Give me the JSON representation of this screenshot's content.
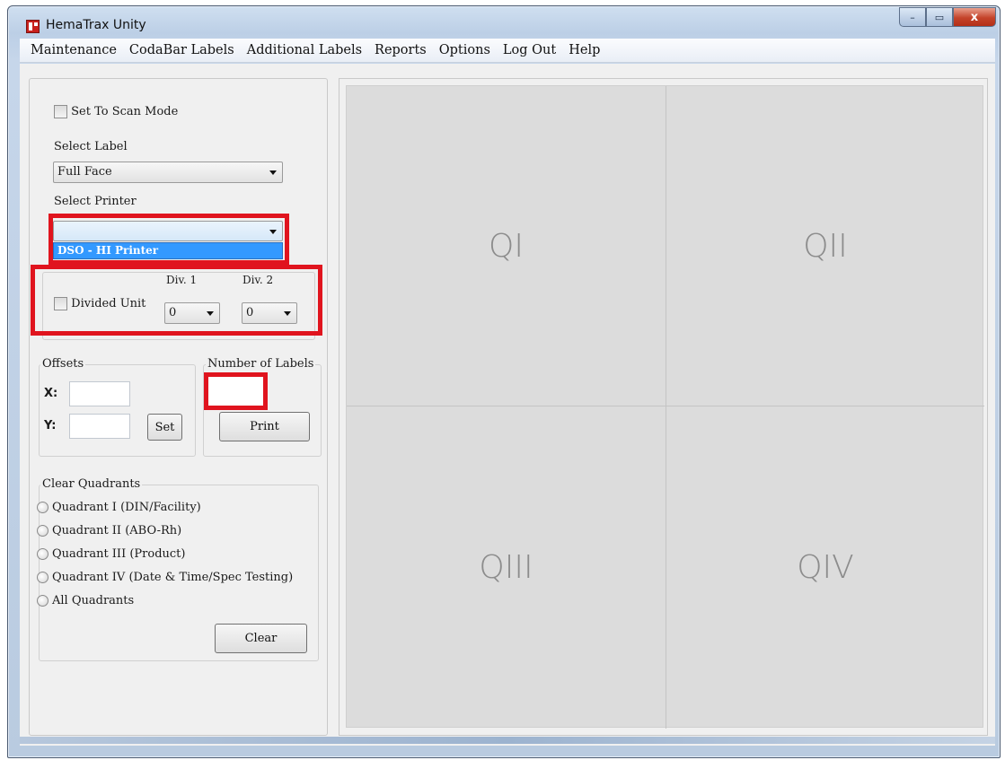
{
  "window": {
    "title": "HemaTrax Unity"
  },
  "title_buttons": {
    "minimize": "–",
    "maximize": "▭",
    "close": "x"
  },
  "menu": [
    "Maintenance",
    "CodaBar Labels",
    "Additional Labels",
    "Reports",
    "Options",
    "Log Out",
    "Help"
  ],
  "left_panel": {
    "scan_mode_label": "Set To Scan Mode",
    "select_label": {
      "label": "Select Label",
      "value": "Full Face"
    },
    "select_printer": {
      "label": "Select Printer",
      "value": "",
      "dropdown_option": "DSO - HI Printer"
    },
    "divided_unit": {
      "label": "Divided Unit",
      "div1_label": "Div. 1",
      "div1_value": "0",
      "div2_label": "Div. 2",
      "div2_value": "0"
    },
    "offsets": {
      "title": "Offsets",
      "x_label": "X:",
      "y_label": "Y:",
      "x_value": "",
      "y_value": "",
      "set_button": "Set"
    },
    "number_of_labels": {
      "title": "Number of Labels",
      "value": "",
      "print_button": "Print"
    },
    "clear_quadrants": {
      "title": "Clear Quadrants",
      "options": [
        "Quadrant I (DIN/Facility)",
        "Quadrant II (ABO-Rh)",
        "Quadrant III (Product)",
        "Quadrant IV (Date & Time/Spec Testing)",
        "All Quadrants"
      ],
      "clear_button": "Clear"
    }
  },
  "quadrants": [
    "QI",
    "QII",
    "QIII",
    "QIV"
  ],
  "colors": {
    "highlight_box": "#e0141e",
    "dropdown_selection": "#3399ff"
  }
}
